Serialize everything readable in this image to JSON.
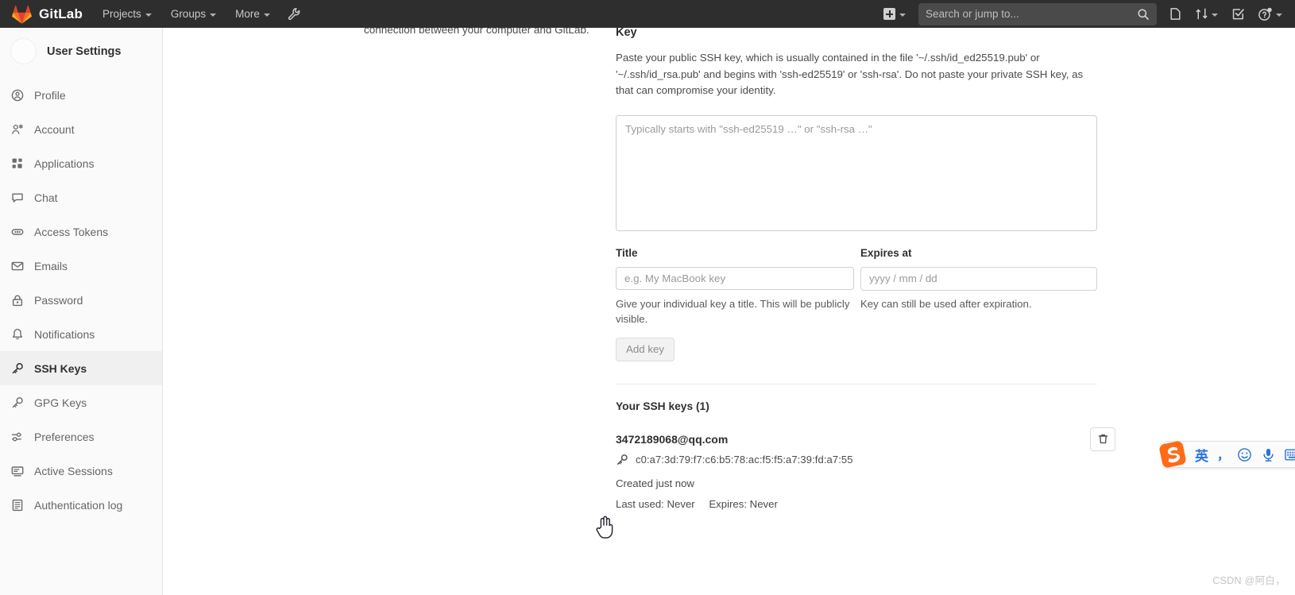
{
  "topnav": {
    "brand": "GitLab",
    "links": [
      {
        "label": "Projects",
        "icon": "chevron-down-icon"
      },
      {
        "label": "Groups",
        "icon": "chevron-down-icon"
      },
      {
        "label": "More",
        "icon": "chevron-down-icon"
      }
    ],
    "wrench_icon": "wrench-icon",
    "create_new_icon": "plus-square-icon",
    "search": {
      "placeholder": "Search or jump to...",
      "value": "",
      "icon": "search-icon"
    },
    "issues_icon": "issues-icon",
    "merge_requests_icon": "merge-request-icon",
    "todos_icon": "todo-check-icon",
    "help_icon": "help-circle-icon"
  },
  "sidebar": {
    "title": "User Settings",
    "avatar": "user-avatar",
    "items": [
      {
        "label": "Profile",
        "icon": "profile-icon",
        "active": false
      },
      {
        "label": "Account",
        "icon": "account-icon",
        "active": false
      },
      {
        "label": "Applications",
        "icon": "applications-grid-icon",
        "active": false
      },
      {
        "label": "Chat",
        "icon": "chat-bubble-icon",
        "active": false
      },
      {
        "label": "Access Tokens",
        "icon": "token-icon",
        "active": false
      },
      {
        "label": "Emails",
        "icon": "envelope-icon",
        "active": false
      },
      {
        "label": "Password",
        "icon": "lock-icon",
        "active": false
      },
      {
        "label": "Notifications",
        "icon": "bell-icon",
        "active": false
      },
      {
        "label": "SSH Keys",
        "icon": "key-icon",
        "active": true
      },
      {
        "label": "GPG Keys",
        "icon": "key-icon",
        "active": false
      },
      {
        "label": "Preferences",
        "icon": "sliders-icon",
        "active": false
      },
      {
        "label": "Active Sessions",
        "icon": "monitor-icon",
        "active": false
      },
      {
        "label": "Authentication log",
        "icon": "log-list-icon",
        "active": false
      }
    ]
  },
  "main": {
    "clipped_text": "connection between your computer and GitLab.",
    "key_section": {
      "title": "Key",
      "description": "Paste your public SSH key, which is usually contained in the file '~/.ssh/id_ed25519.pub' or '~/.ssh/id_rsa.pub' and begins with 'ssh-ed25519' or 'ssh-rsa'. Do not paste your private SSH key, as that can compromise your identity.",
      "textarea_placeholder": "Typically starts with \"ssh-ed25519 …\" or \"ssh-rsa …\"",
      "textarea_value": ""
    },
    "title_field": {
      "label": "Title",
      "placeholder": "e.g. My MacBook key",
      "value": "",
      "hint": "Give your individual key a title. This will be publicly visible."
    },
    "expires_field": {
      "label": "Expires at",
      "placeholder": "yyyy / mm / dd",
      "value": "",
      "hint": "Key can still be used after expiration."
    },
    "add_key_button": "Add key",
    "keys_heading": "Your SSH keys (1)",
    "keys": [
      {
        "name": "3472189068@qq.com",
        "fingerprint": "c0:a7:3d:79:f7:c6:b5:78:ac:f5:f5:a7:39:fd:a7:55",
        "fingerprint_icon": "key-icon",
        "created": "Created just now",
        "last_used": "Last used: Never",
        "expires": "Expires: Never",
        "delete_icon": "trash-icon"
      }
    ]
  },
  "ime": {
    "logo": "sogou-logo-icon",
    "mode": "英",
    "punctuation": "，",
    "emoji_icon": "smiley-icon",
    "mic_icon": "microphone-icon",
    "keyboard_icon": "keyboard-icon"
  },
  "watermark": "CSDN @阿白，",
  "colors": {
    "nav_bg": "#2e2e2e",
    "sidebar_bg": "#fafafa",
    "active_item_bg": "#f0f0f0",
    "text_primary": "#303030",
    "text_secondary": "#4b4b4b",
    "border": "#cfcfcf",
    "gitlab_orange": "#e24329",
    "ime_blue": "#2a74d8"
  }
}
